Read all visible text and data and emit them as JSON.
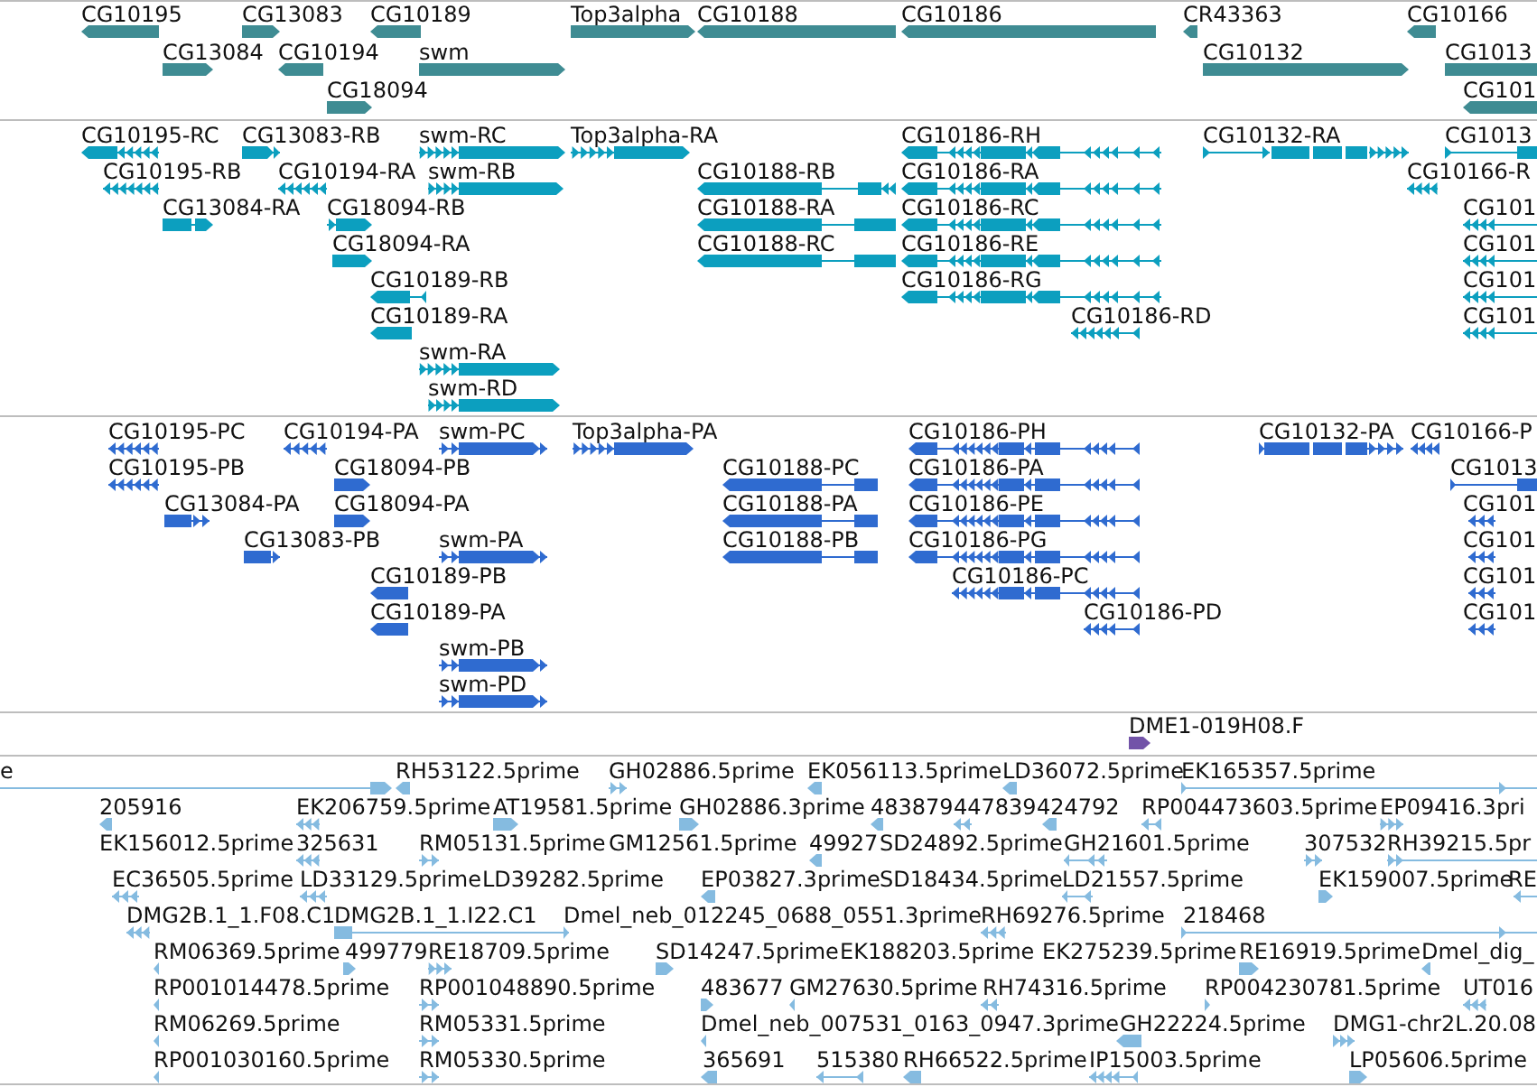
{
  "tracks": [
    {
      "kind": "gene",
      "features": [
        {
          "label": "CG10195",
          "reverse": true
        },
        {
          "label": "CG13083",
          "reverse": false
        },
        {
          "label": "CG10189",
          "reverse": true
        },
        {
          "label": "Top3alpha",
          "reverse": false
        },
        {
          "label": "CG10188",
          "reverse": true
        },
        {
          "label": "CG10186",
          "reverse": true
        },
        {
          "label": "CR43363",
          "reverse": true
        },
        {
          "label": "CG10166",
          "reverse": true
        },
        {
          "label": "CG13084",
          "reverse": false
        },
        {
          "label": "CG10194",
          "reverse": true
        },
        {
          "label": "swm",
          "reverse": false
        },
        {
          "label": "CG10132",
          "reverse": false
        },
        {
          "label": "CG1013",
          "reverse": false
        },
        {
          "label": "CG18094",
          "reverse": false
        },
        {
          "label": "CG101",
          "reverse": true
        }
      ]
    },
    {
      "kind": "transcript",
      "features": [
        {
          "label": "CG10195-RC",
          "reverse": true
        },
        {
          "label": "CG13083-RB",
          "reverse": false
        },
        {
          "label": "swm-RC",
          "reverse": false
        },
        {
          "label": "Top3alpha-RA",
          "reverse": false
        },
        {
          "label": "CG10186-RH",
          "reverse": true
        },
        {
          "label": "CG10132-RA",
          "reverse": false
        },
        {
          "label": "CG1013",
          "reverse": false
        },
        {
          "label": "CG10195-RB",
          "reverse": true
        },
        {
          "label": "CG10194-RA",
          "reverse": true
        },
        {
          "label": "swm-RB",
          "reverse": false
        },
        {
          "label": "CG10188-RB",
          "reverse": true
        },
        {
          "label": "CG10186-RA",
          "reverse": true
        },
        {
          "label": "CG10166-R",
          "reverse": true
        },
        {
          "label": "CG13084-RA",
          "reverse": false
        },
        {
          "label": "CG18094-RB",
          "reverse": false
        },
        {
          "label": "CG10188-RA",
          "reverse": true
        },
        {
          "label": "CG10186-RC",
          "reverse": true
        },
        {
          "label": "CG101",
          "reverse": true
        },
        {
          "label": "CG18094-RA",
          "reverse": false
        },
        {
          "label": "CG10188-RC",
          "reverse": true
        },
        {
          "label": "CG10186-RE",
          "reverse": true
        },
        {
          "label": "CG101",
          "reverse": true
        },
        {
          "label": "CG10189-RB",
          "reverse": true
        },
        {
          "label": "CG10186-RG",
          "reverse": true
        },
        {
          "label": "CG101",
          "reverse": true
        },
        {
          "label": "CG10189-RA",
          "reverse": true
        },
        {
          "label": "CG10186-RD",
          "reverse": true
        },
        {
          "label": "CG101",
          "reverse": true
        },
        {
          "label": "swm-RA",
          "reverse": false
        },
        {
          "label": "swm-RD",
          "reverse": false
        }
      ]
    },
    {
      "kind": "protein",
      "features": [
        {
          "label": "CG10195-PC",
          "reverse": true
        },
        {
          "label": "CG10194-PA",
          "reverse": true
        },
        {
          "label": "swm-PC",
          "reverse": false
        },
        {
          "label": "Top3alpha-PA",
          "reverse": false
        },
        {
          "label": "CG10186-PH",
          "reverse": true
        },
        {
          "label": "CG10132-PA",
          "reverse": false
        },
        {
          "label": "CG10166-P",
          "reverse": true
        },
        {
          "label": "CG10195-PB",
          "reverse": true
        },
        {
          "label": "CG18094-PB",
          "reverse": false
        },
        {
          "label": "CG10188-PC",
          "reverse": true
        },
        {
          "label": "CG10186-PA",
          "reverse": true
        },
        {
          "label": "CG1013",
          "reverse": false
        },
        {
          "label": "CG13084-PA",
          "reverse": false
        },
        {
          "label": "CG18094-PA",
          "reverse": false
        },
        {
          "label": "CG10188-PA",
          "reverse": true
        },
        {
          "label": "CG10186-PE",
          "reverse": true
        },
        {
          "label": "CG101",
          "reverse": true
        },
        {
          "label": "CG13083-PB",
          "reverse": false
        },
        {
          "label": "swm-PA",
          "reverse": false
        },
        {
          "label": "CG10188-PB",
          "reverse": true
        },
        {
          "label": "CG10186-PG",
          "reverse": true
        },
        {
          "label": "CG101",
          "reverse": true
        },
        {
          "label": "CG10189-PB",
          "reverse": true
        },
        {
          "label": "CG10186-PC",
          "reverse": true
        },
        {
          "label": "CG101",
          "reverse": true
        },
        {
          "label": "CG10189-PA",
          "reverse": true
        },
        {
          "label": "CG10186-PD",
          "reverse": true
        },
        {
          "label": "CG101",
          "reverse": true
        },
        {
          "label": "swm-PB",
          "reverse": false
        },
        {
          "label": "swm-PD",
          "reverse": false
        }
      ]
    },
    {
      "kind": "clone",
      "features": [
        {
          "label": "DME1-019H08.F",
          "reverse": false
        }
      ]
    },
    {
      "kind": "est",
      "features": [
        {
          "label": "e",
          "reverse": false
        },
        {
          "label": "RH53122.5prime",
          "reverse": true
        },
        {
          "label": "GH02886.5prime",
          "reverse": false
        },
        {
          "label": "EK056113.5prime",
          "reverse": true
        },
        {
          "label": "LD36072.5prime",
          "reverse": true
        },
        {
          "label": "EK165357.5prime",
          "reverse": false
        },
        {
          "label": "205916",
          "reverse": true
        },
        {
          "label": "EK206759.5prime",
          "reverse": true
        },
        {
          "label": "AT19581.5prime",
          "reverse": false
        },
        {
          "label": "GH02886.3prime",
          "reverse": false
        },
        {
          "label": "483879",
          "reverse": true
        },
        {
          "label": "447839",
          "reverse": true
        },
        {
          "label": "424792",
          "reverse": true
        },
        {
          "label": "RP004473603.5prime",
          "reverse": true
        },
        {
          "label": "EP09416.3pri",
          "reverse": false
        },
        {
          "label": "EK156012.5prime"
        },
        {
          "label": "325631",
          "reverse": true
        },
        {
          "label": "RM05131.5prime",
          "reverse": false
        },
        {
          "label": "GM12561.5prime"
        },
        {
          "label": "49927",
          "reverse": true
        },
        {
          "label": "SD24892.5prime"
        },
        {
          "label": "GH21601.5prime",
          "reverse": true
        },
        {
          "label": "307532",
          "reverse": false
        },
        {
          "label": "RH39215.5pr",
          "reverse": false
        },
        {
          "label": "EC36505.5prime",
          "reverse": true
        },
        {
          "label": "LD33129.5prime",
          "reverse": true
        },
        {
          "label": "LD39282.5prime"
        },
        {
          "label": "EP03827.3prime",
          "reverse": true
        },
        {
          "label": "SD18434.5prime"
        },
        {
          "label": "LD21557.5prime",
          "reverse": true
        },
        {
          "label": "EK159007.5prime",
          "reverse": false
        },
        {
          "label": "RE",
          "reverse": true
        },
        {
          "label": "DMG2B.1_1.F08.C1",
          "reverse": true
        },
        {
          "label": "DMG2B.1_1.I22.C1",
          "reverse": false
        },
        {
          "label": "Dmel_neb_012245_0688_0551.3prime"
        },
        {
          "label": "RH69276.5prime",
          "reverse": true
        },
        {
          "label": "218468",
          "reverse": false
        },
        {
          "label": "RM06369.5prime",
          "reverse": true
        },
        {
          "label": "499779",
          "reverse": false
        },
        {
          "label": "RE18709.5prime",
          "reverse": false
        },
        {
          "label": "SD14247.5prime",
          "reverse": false
        },
        {
          "label": "EK188203.5prime"
        },
        {
          "label": "EK275239.5prime"
        },
        {
          "label": "RE16919.5prime",
          "reverse": false
        },
        {
          "label": "Dmel_dig_",
          "reverse": true
        },
        {
          "label": "RP001014478.5prime",
          "reverse": true
        },
        {
          "label": "RP001048890.5prime",
          "reverse": false
        },
        {
          "label": "483677",
          "reverse": false
        },
        {
          "label": "GM27630.5prime",
          "reverse": true
        },
        {
          "label": "RH74316.5prime",
          "reverse": true
        },
        {
          "label": "RP004230781.5prime",
          "reverse": false
        },
        {
          "label": "UT016",
          "reverse": true
        },
        {
          "label": "RM06269.5prime",
          "reverse": true
        },
        {
          "label": "RM05331.5prime",
          "reverse": false
        },
        {
          "label": "Dmel_neb_007531_0163_0947.3prime",
          "reverse": true
        },
        {
          "label": "GH22224.5prime",
          "reverse": true
        },
        {
          "label": "DMG1-chr2L.20.08",
          "reverse": false
        },
        {
          "label": "RP001030160.5prime",
          "reverse": true
        },
        {
          "label": "RM05330.5prime",
          "reverse": false
        },
        {
          "label": "365691",
          "reverse": true
        },
        {
          "label": "515380",
          "reverse": true
        },
        {
          "label": "RH66522.5prime",
          "reverse": true
        },
        {
          "label": "IP15003.5prime",
          "reverse": true
        },
        {
          "label": "LP05606.5prime",
          "reverse": false
        }
      ]
    }
  ]
}
